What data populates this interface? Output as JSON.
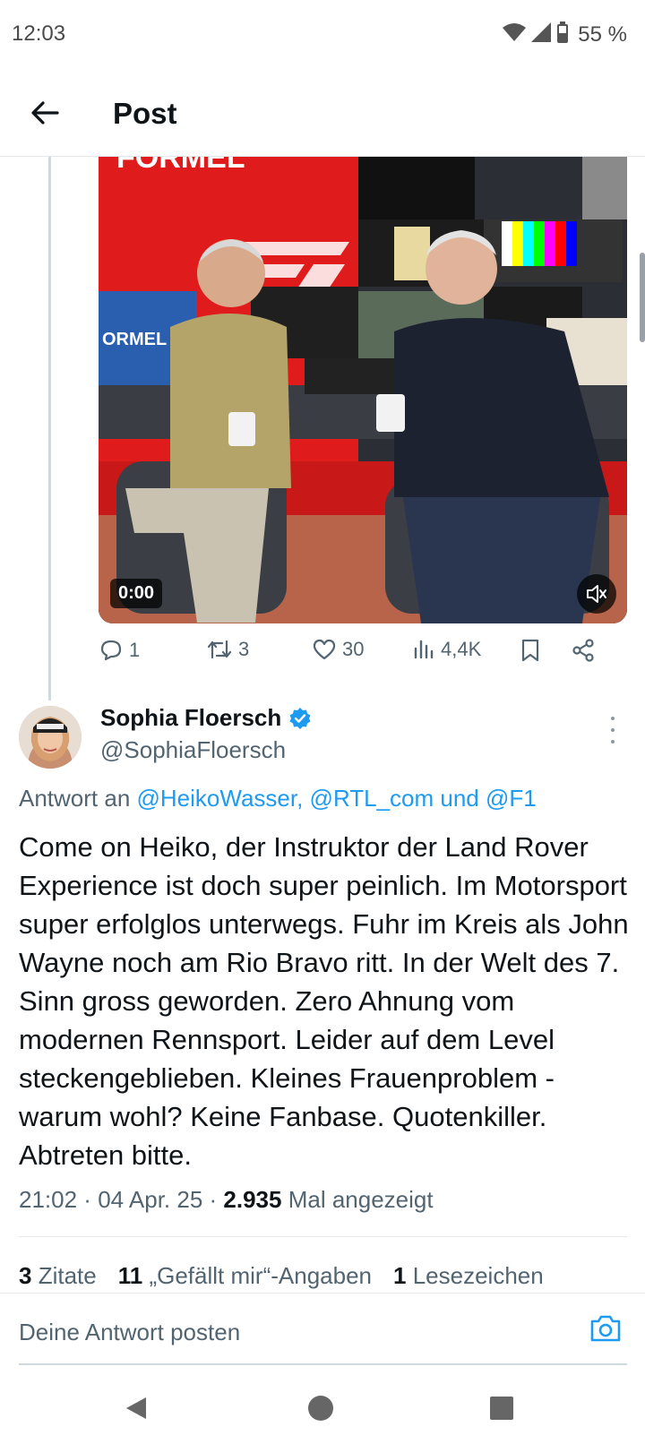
{
  "status_bar": {
    "time": "12:03",
    "battery": "55 %"
  },
  "header": {
    "title": "Post"
  },
  "video": {
    "time": "0:00",
    "screen_text_top": "FORMEL",
    "screen_text_left": "ORMEL"
  },
  "actions": {
    "replies": "1",
    "reposts": "3",
    "likes": "30",
    "views": "4,4K"
  },
  "reply": {
    "display_name": "Sophia Floersch",
    "handle": "@SophiaFloersch",
    "reply_prefix": "Antwort an ",
    "reply_targets": "@HeikoWasser, @RTL_com und @F1",
    "text": "Come on Heiko, der Instruktor der Land Rover Experience ist doch super peinlich. Im Motorsport super erfolglos unterwegs. Fuhr im Kreis als John Wayne noch am Rio Bravo ritt. In der Welt des 7. Sinn gross geworden. Zero Ahnung vom modernen Rennsport. Leider auf dem Level steckengeblieben. Kleines Frauenproblem - warum wohl? Keine Fanbase. Quotenkiller. Abtreten bitte.",
    "time": "21:02",
    "date": "04 Apr. 25",
    "sep": " · ",
    "views_count": "2.935",
    "views_label": "Mal angezeigt",
    "quotes_count": "3",
    "quotes_label": "Zitate",
    "likes_count": "11",
    "likes_label": "„Gefällt mir“-Angaben",
    "bookmarks_count": "1",
    "bookmarks_label": "Lesezeichen"
  },
  "compose": {
    "placeholder": "Deine Antwort posten"
  },
  "colors": {
    "accent": "#1d9bf0",
    "secondary_text": "#536471",
    "primary_text": "#0f1419"
  }
}
